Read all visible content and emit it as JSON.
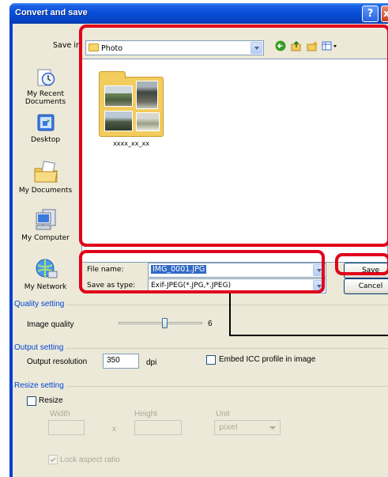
{
  "window": {
    "title": "Convert and save",
    "help_glyph": "?",
    "close_glyph": "x"
  },
  "savein": {
    "label": "Save in:",
    "value": "Photo"
  },
  "places": [
    {
      "label": "My Recent Documents",
      "icon": "recent-documents-icon"
    },
    {
      "label": "Desktop",
      "icon": "desktop-icon"
    },
    {
      "label": "My Documents",
      "icon": "my-documents-icon"
    },
    {
      "label": "My Computer",
      "icon": "my-computer-icon"
    },
    {
      "label": "My Network",
      "icon": "my-network-icon"
    }
  ],
  "files": [
    {
      "name": "xxxx_xx_xx",
      "icon": "folder-thumbnail-icon"
    }
  ],
  "filename": {
    "label": "File name:",
    "value": "IMG_0001.JPG"
  },
  "filetype": {
    "label": "Save as type:",
    "value": "Exif-JPEG(*.JPG,*.JPEG)"
  },
  "buttons": {
    "save": "Save",
    "cancel": "Cancel"
  },
  "quality": {
    "title": "Quality setting",
    "label": "Image quality",
    "value": "6",
    "level_fraction": 0.55
  },
  "output": {
    "title": "Output setting",
    "label": "Output resolution",
    "value": "350",
    "unit": "dpi",
    "embed_label": "Embed ICC profile in image"
  },
  "resize": {
    "title": "Resize setting",
    "checkbox_label": "Resize",
    "width_label": "Width",
    "height_label": "Height",
    "unit_label": "Unit",
    "x_label": "x",
    "unit_value": "pixel",
    "lock_label": "Lock aspect ratio"
  },
  "colors": {
    "highlight": "#e0001b",
    "titlebar": "#0a4fd8",
    "group_title": "#0046d5"
  }
}
